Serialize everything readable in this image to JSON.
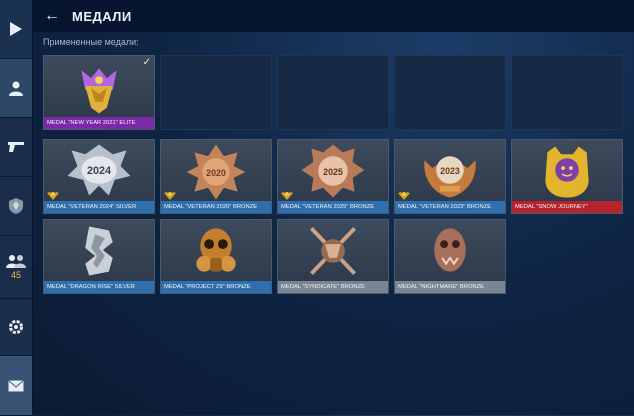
{
  "header": {
    "title": "МЕДАЛИ"
  },
  "applied": {
    "label": "Примененные медали:",
    "slots": [
      {
        "name": "MEDAL \"NEW YEAR 2021\" ELITE",
        "checked": true
      },
      {},
      {},
      {},
      {}
    ]
  },
  "medals": [
    {
      "name": "MEDAL \"VETERAN 2024\" SILVER",
      "rank_badge": true,
      "art_text": "2024"
    },
    {
      "name": "MEDAL \"VETERAN 2020\" BRONZE",
      "rank_badge": true,
      "art_text": "2020"
    },
    {
      "name": "MEDAL \"VETERAN 2025\" BRONZE",
      "rank_badge": true,
      "art_text": "2025"
    },
    {
      "name": "MEDAL \"VETERAN 2023\" BRONZE",
      "rank_badge": true,
      "art_text": "2023"
    },
    {
      "name": "MEDAL \"SNOW JOURNEY\"",
      "rank_badge": false
    },
    {
      "name": "MEDAL \"DRAGON RISE\" SILVER",
      "rank_badge": false
    },
    {
      "name": "MEDAL \"PROJECT Z9\" BRONZE",
      "rank_badge": false
    },
    {
      "name": "MEDAL \"SYNDICATE\" BRONZE",
      "rank_badge": false
    },
    {
      "name": "MEDAL \"NIGHTMARE\" BRONZE",
      "rank_badge": false
    }
  ],
  "sidebar": {
    "friends_count": "45"
  },
  "colors": {
    "silver_bar": "#2f6fae",
    "grey_bar": "#7a8593",
    "red_bar": "#b5242c",
    "elite_bar": "#7b29a8",
    "accent": "#e0c040"
  }
}
